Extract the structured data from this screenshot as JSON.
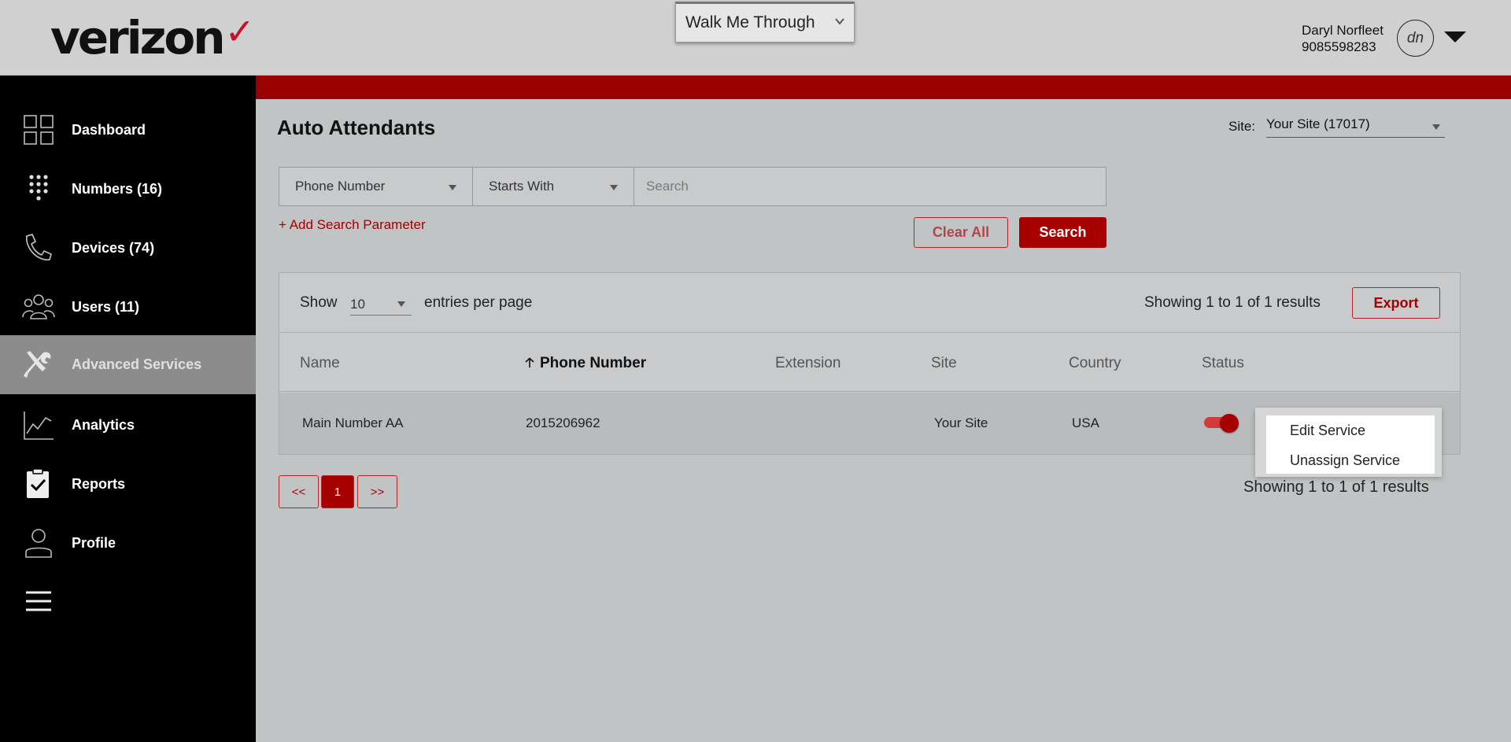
{
  "brand": {
    "logo_text": "verizon",
    "logo_mark": "✓",
    "accent": "#a60000"
  },
  "header": {
    "walkme_label": "Walk Me Through",
    "user_name": "Daryl Norfleet",
    "user_phone": "9085598283",
    "avatar_initials": "dn"
  },
  "sidebar": {
    "items": [
      {
        "label": "Dashboard",
        "icon": "dashboard-grid-icon"
      },
      {
        "label": "Numbers (16)",
        "icon": "keypad-icon"
      },
      {
        "label": "Devices (74)",
        "icon": "phone-icon"
      },
      {
        "label": "Users (11)",
        "icon": "users-icon"
      },
      {
        "label": "Advanced Services",
        "icon": "tools-icon",
        "active": true
      },
      {
        "label": "Analytics",
        "icon": "analytics-icon"
      },
      {
        "label": "Reports",
        "icon": "clipboard-check-icon"
      },
      {
        "label": "Profile",
        "icon": "profile-icon"
      },
      {
        "label": "",
        "icon": "hamburger-menu-icon"
      }
    ]
  },
  "main": {
    "title": "Auto Attendants",
    "site_label": "Site:",
    "site_value": "Your Site (17017)",
    "search": {
      "field_value": "Phone Number",
      "operator_value": "Starts With",
      "placeholder": "Search",
      "add_param": "+ Add Search Parameter",
      "clear_label": "Clear All",
      "search_label": "Search"
    },
    "table": {
      "show_label": "Show",
      "entries_value": "10",
      "entries_label": "entries per page",
      "showing_text": "Showing 1 to 1 of 1 results",
      "export_label": "Export",
      "columns": [
        "Name",
        "Phone Number",
        "Extension",
        "Site",
        "Country",
        "Status"
      ],
      "sorted_column": "Phone Number",
      "rows": [
        {
          "name": "Main Number AA",
          "phone": "2015206962",
          "extension": "",
          "site": "Your Site",
          "country": "USA",
          "status_on": true
        }
      ]
    },
    "context_menu": [
      "Edit Service",
      "Unassign Service"
    ],
    "pagination": {
      "prev": "<<",
      "current": "1",
      "next": ">>",
      "showing_text": "Showing 1 to 1 of 1 results"
    }
  }
}
